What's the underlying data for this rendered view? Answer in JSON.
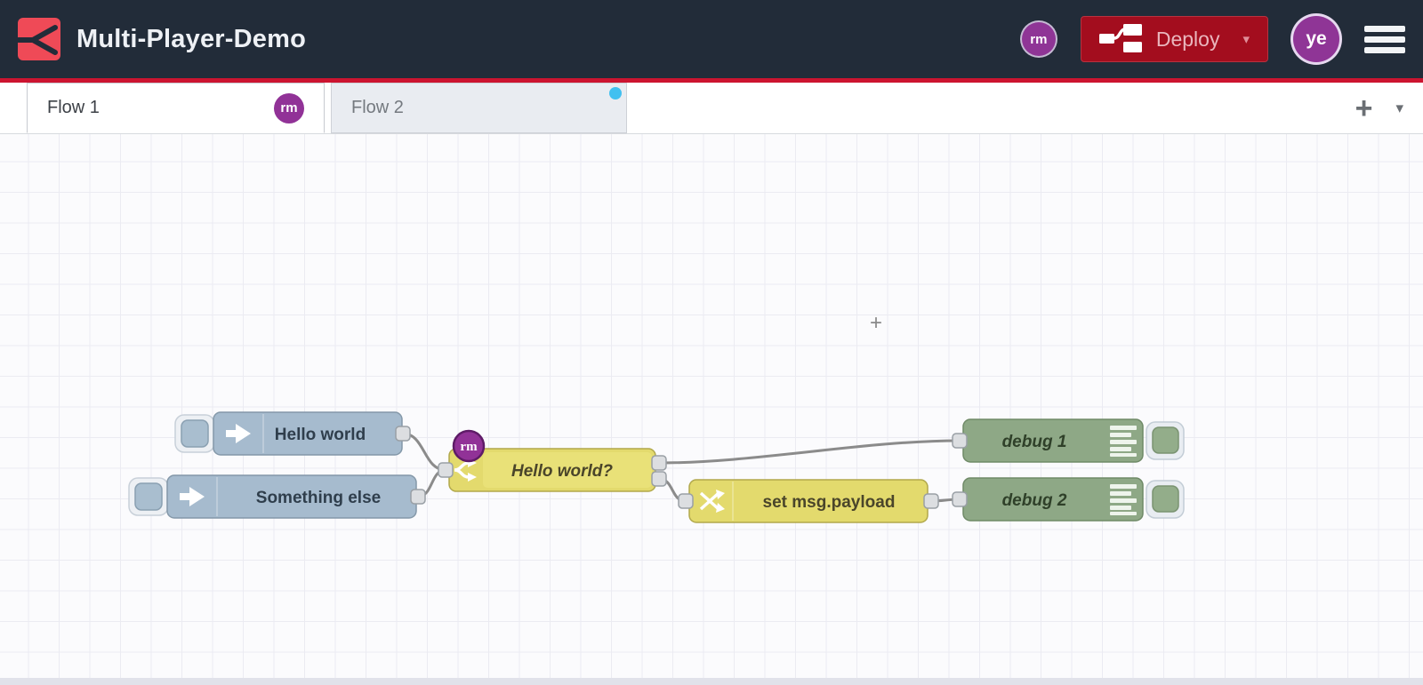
{
  "header": {
    "title": "Multi-Player-Demo",
    "collaborator_initials": "rm",
    "user_initials": "ye",
    "deploy_label": "Deploy",
    "deploy_caret": "▾"
  },
  "tabs": {
    "flow1": {
      "label": "Flow 1",
      "badge": "rm",
      "active": true
    },
    "flow2": {
      "label": "Flow 2",
      "has_unsaved_changes_dot": true
    },
    "add_icon": "+",
    "menu_icon": "▾"
  },
  "canvas": {
    "cursor_glyph": "+",
    "nodes": [
      {
        "id": "inject-1",
        "type": "inject",
        "label": "Hello world"
      },
      {
        "id": "inject-2",
        "type": "inject",
        "label": "Something else"
      },
      {
        "id": "switch-1",
        "type": "switch",
        "label": "Hello world?",
        "badge": "rm",
        "outputs": 2
      },
      {
        "id": "change-1",
        "type": "change",
        "label": "set msg.payload"
      },
      {
        "id": "debug-1",
        "type": "debug",
        "label": "debug 1"
      },
      {
        "id": "debug-2",
        "type": "debug",
        "label": "debug 2"
      }
    ],
    "wires": [
      {
        "from": "inject-1",
        "to": "switch-1"
      },
      {
        "from": "inject-2",
        "to": "switch-1"
      },
      {
        "from": "switch-1:output-1",
        "to": "debug-1"
      },
      {
        "from": "switch-1:output-2",
        "to": "change-1"
      },
      {
        "from": "change-1",
        "to": "debug-2"
      }
    ]
  },
  "colors": {
    "header_bg": "#222c39",
    "accent_red_line": "#cc1430",
    "logo_red": "#ef4a57",
    "deploy_bg": "#a30d1e",
    "avatar_purple": "#8f3596",
    "inject_blue": "#a6bbce",
    "function_yellow": "#e3da6d",
    "debug_green": "#8ea886",
    "wire_gray": "#8b8b8b",
    "tab_inactive_bg": "#e9ecf1",
    "unsaved_dot_blue": "#41c0f0",
    "grid_line": "#ebebf2"
  }
}
